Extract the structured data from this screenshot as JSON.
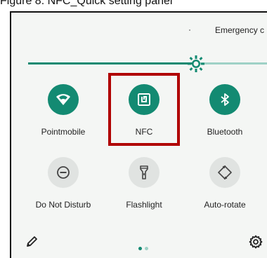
{
  "caption": "Figure 8. NFC_Quick setting panel",
  "status": {
    "emergency_label": "Emergency c"
  },
  "brightness": {
    "level": 0.73
  },
  "tiles": [
    {
      "label": "Pointmobile",
      "icon": "wifi-icon",
      "active": true
    },
    {
      "label": "NFC",
      "icon": "nfc-icon",
      "active": true
    },
    {
      "label": "Bluetooth",
      "icon": "bluetooth-icon",
      "active": true
    },
    {
      "label": "Do Not Disturb",
      "icon": "do-not-disturb-icon",
      "active": false
    },
    {
      "label": "Flashlight",
      "icon": "flashlight-icon",
      "active": false
    },
    {
      "label": "Auto-rotate",
      "icon": "auto-rotate-icon",
      "active": false
    }
  ],
  "pager": {
    "pages": 2,
    "current": 1
  },
  "colors": {
    "accent": "#138a72",
    "accent_light": "#9fd1c6",
    "inactive_tile": "#e0e3e1",
    "highlight_box": "#b00000",
    "panel_bg": "#f4f6f4"
  }
}
